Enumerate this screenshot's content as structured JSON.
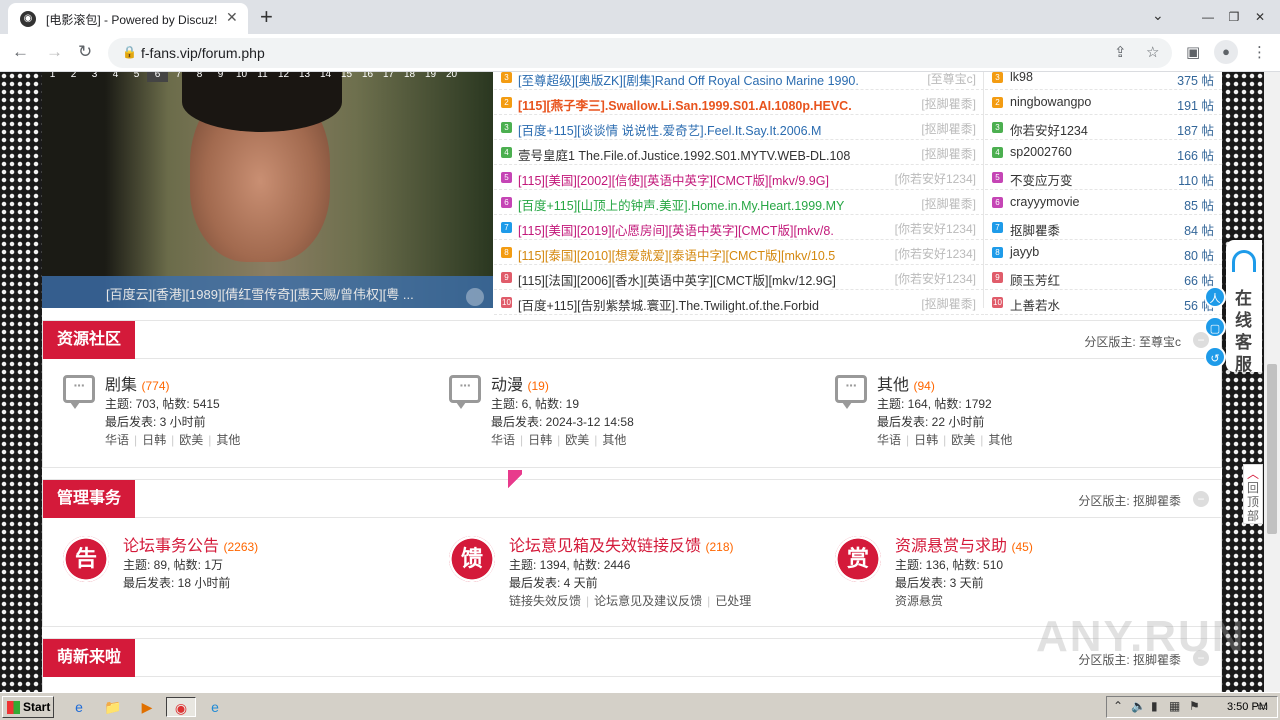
{
  "browser": {
    "tab_title": "[电影滚包] - Powered by Discuz!",
    "url": "f-fans.vip/forum.php",
    "new_tab": "+",
    "tab_close": "✕",
    "controls": {
      "tab_search": "⌄",
      "minimize": "—",
      "restore": "❐",
      "close": "✕"
    }
  },
  "slideshow": {
    "numbers": [
      "1",
      "2",
      "3",
      "4",
      "5",
      "6",
      "7",
      "8",
      "9",
      "10",
      "11",
      "12",
      "13",
      "14",
      "15",
      "16",
      "17",
      "18",
      "19",
      "20"
    ],
    "active": "6",
    "caption": "[百度云][香港][1989][倩红雪传奇][惠天赐/曾伟权][粤 ..."
  },
  "threads": [
    {
      "no": "3",
      "color": "#f39c12",
      "title": "[至尊超级][奥版ZK][剧集]Rand Off Royal Casino Marine 1990.",
      "title_color": "#2b6cb0",
      "author": "[至尊宝c]",
      "partial": true
    },
    {
      "no": "2",
      "color": "#f39c12",
      "title": "[115][燕子李三].Swallow.Li.San.1999.S01.AI.1080p.HEVC.",
      "title_color": "#e8541e",
      "author": "[抠脚瞿黍]",
      "bold": true
    },
    {
      "no": "3",
      "color": "#4caf50",
      "title": "[百度+115][谈谈情 说说性.爱奇艺].Feel.It.Say.It.2006.M",
      "title_color": "#2b6cb0",
      "author": "[抠脚瞿黍]"
    },
    {
      "no": "4",
      "color": "#4caf50",
      "title": "壹号皇庭1 The.File.of.Justice.1992.S01.MYTV.WEB-DL.108",
      "title_color": "#333333",
      "author": "[抠脚瞿黍]"
    },
    {
      "no": "5",
      "color": "#c545b5",
      "title": "[115][美国][2002][信使][英语中英字][CMCT版][mkv/9.9G]",
      "title_color": "#c2187a",
      "author": "[你若安好1234]"
    },
    {
      "no": "6",
      "color": "#c545b5",
      "title": "[百度+115][山顶上的钟声.美亚].Home.in.My.Heart.1999.MY",
      "title_color": "#28a745",
      "author": "[抠脚瞿黍]"
    },
    {
      "no": "7",
      "color": "#1e9be9",
      "title": "[115][美国][2019][心愿房间][英语中英字][CMCT版][mkv/8.",
      "title_color": "#c2187a",
      "author": "[你若安好1234]"
    },
    {
      "no": "8",
      "color": "#f39c12",
      "title": "[115][泰国][2010][想爱就爱][泰语中字][CMCT版][mkv/10.5",
      "title_color": "#d4880f",
      "author": "[你若安好1234]"
    },
    {
      "no": "9",
      "color": "#e05c6a",
      "title": "[115][法国][2006][香水][英语中英字][CMCT版][mkv/12.9G]",
      "title_color": "#333333",
      "author": "[你若安好1234]"
    },
    {
      "no": "10",
      "color": "#e05c6a",
      "title": "[百度+115][告别紫禁城.寰亚].The.Twilight.of.the.Forbid",
      "title_color": "#333333",
      "author": "[抠脚瞿黍]"
    }
  ],
  "users": [
    {
      "no": "3",
      "color": "#f39c12",
      "name": "lk98",
      "count": "375 帖",
      "partial": true
    },
    {
      "no": "2",
      "color": "#f39c12",
      "name": "ningbowangpo",
      "count": "191 帖"
    },
    {
      "no": "3",
      "color": "#4caf50",
      "name": "你若安好1234",
      "count": "187 帖"
    },
    {
      "no": "4",
      "color": "#4caf50",
      "name": "sp2002760",
      "count": "166 帖"
    },
    {
      "no": "5",
      "color": "#c545b5",
      "name": "不变应万变",
      "count": "110 帖"
    },
    {
      "no": "6",
      "color": "#c545b5",
      "name": "crayyymovie",
      "count": "85 帖"
    },
    {
      "no": "7",
      "color": "#1e9be9",
      "name": "抠脚瞿黍",
      "count": "84 帖"
    },
    {
      "no": "8",
      "color": "#1e9be9",
      "name": "jayyb",
      "count": "80 帖"
    },
    {
      "no": "9",
      "color": "#e05c6a",
      "name": "顾玉芳红",
      "count": "66 帖"
    },
    {
      "no": "10",
      "color": "#e05c6a",
      "name": "上善若水",
      "count": "56 帖"
    }
  ],
  "sections": [
    {
      "title": "资源社区",
      "moderator": "分区版主: 至尊宝c",
      "collapse": "−",
      "forums": [
        {
          "name": "剧集",
          "count": "(774)",
          "stats": "主题: 703, 帖数: 5415",
          "last": "最后发表: 3 小时前",
          "subs": [
            "华语",
            "日韩",
            "欧美",
            "其他"
          ],
          "icon": "speech",
          "name_color": "#333333",
          "icon_text": "···"
        },
        {
          "name": "动漫",
          "count": "(19)",
          "stats": "主题: 6, 帖数: 19",
          "last": "最后发表: 2024-3-12 14:58",
          "subs": [
            "华语",
            "日韩",
            "欧美",
            "其他"
          ],
          "icon": "speech",
          "name_color": "#333333",
          "icon_text": "···"
        },
        {
          "name": "其他",
          "count": "(94)",
          "stats": "主题: 164, 帖数: 1792",
          "last": "最后发表: 22 小时前",
          "subs": [
            "华语",
            "日韩",
            "欧美",
            "其他"
          ],
          "icon": "speech",
          "name_color": "#333333",
          "icon_text": "···"
        }
      ]
    },
    {
      "title": "管理事务",
      "moderator": "分区版主: 抠脚瞿黍",
      "collapse": "−",
      "forums": [
        {
          "name": "论坛事务公告",
          "count": "(2263)",
          "stats": "主题: 89, 帖数: 1万",
          "last": "最后发表: 18 小时前",
          "subs": [],
          "icon": "round",
          "icon_text": "告",
          "name_color": "#d41a3a"
        },
        {
          "name": "论坛意见箱及失效链接反馈",
          "count": "(218)",
          "stats": "主题: 1394, 帖数: 2446",
          "last": "最后发表: 4 天前",
          "subs": [
            "链接失效反馈",
            "论坛意见及建议反馈",
            "已处理"
          ],
          "icon": "round",
          "icon_text": "馈",
          "name_color": "#d41a3a"
        },
        {
          "name": "资源悬赏与求助",
          "count": "(45)",
          "stats": "主题: 136, 帖数: 510",
          "last": "最后发表: 3 天前",
          "subs": [
            "资源悬赏"
          ],
          "icon": "round",
          "icon_text": "赏",
          "name_color": "#d41a3a"
        }
      ]
    },
    {
      "title": "萌新来啦",
      "moderator": "分区版主: 抠脚瞿黍",
      "collapse": "−",
      "forums": []
    }
  ],
  "sidebar_widget": {
    "label": "在线客服",
    "bubbles": [
      "人",
      "▢",
      "↺"
    ]
  },
  "back_to_top": {
    "arrow": "︿",
    "label": "回顶部"
  },
  "watermark": "ANY.RUN",
  "taskbar": {
    "start": "Start",
    "clock": "3:50 PM",
    "apps": [
      "e",
      "📁",
      "▶",
      "◉",
      "e"
    ]
  }
}
